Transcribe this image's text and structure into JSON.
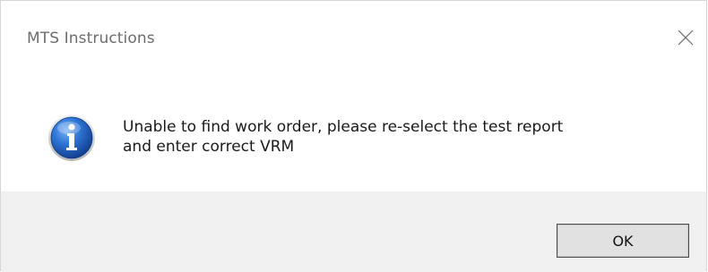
{
  "window": {
    "title": "MTS Instructions",
    "close_icon": "close-icon"
  },
  "content": {
    "icon": "info-icon",
    "message_line1": "Unable to find work order, please re-select the test report",
    "message_line2": "and enter correct VRM"
  },
  "footer": {
    "ok_label": "OK"
  },
  "colors": {
    "footer_background": "#f0f0f0",
    "button_background": "#e1e1e1",
    "info_icon_blue": "#1e62c7"
  }
}
